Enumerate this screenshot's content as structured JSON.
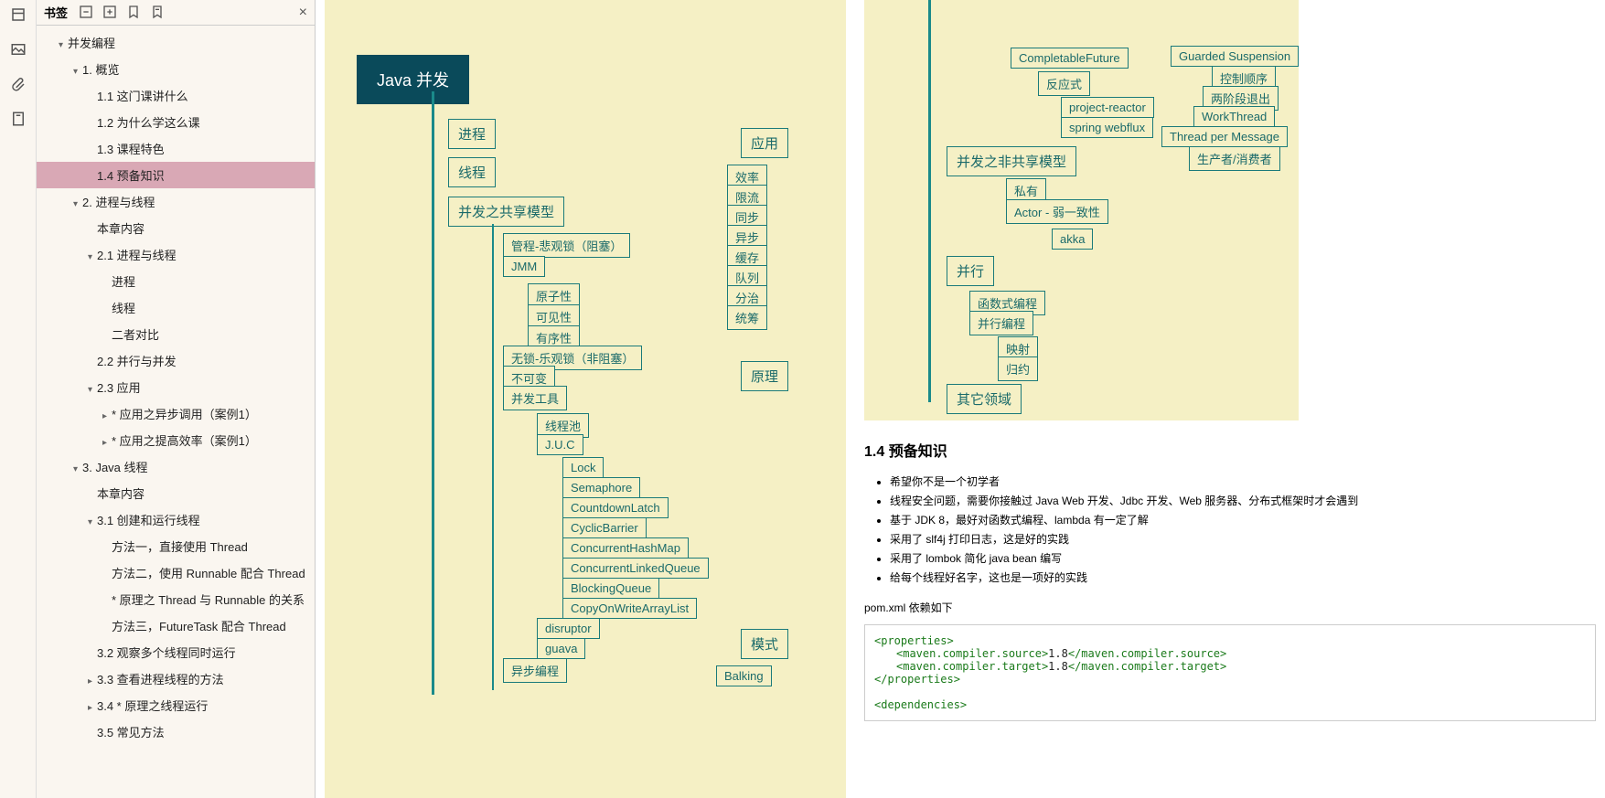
{
  "sidebar": {
    "title": "书签",
    "items": [
      {
        "label": "并发编程",
        "indent": 1,
        "arrow": "▾"
      },
      {
        "label": "1. 概览",
        "indent": 2,
        "arrow": "▾"
      },
      {
        "label": "1.1 这门课讲什么",
        "indent": 3,
        "arrow": ""
      },
      {
        "label": "1.2 为什么学这么课",
        "indent": 3,
        "arrow": ""
      },
      {
        "label": "1.3 课程特色",
        "indent": 3,
        "arrow": ""
      },
      {
        "label": "1.4 预备知识",
        "indent": 3,
        "arrow": "",
        "selected": true
      },
      {
        "label": "2. 进程与线程",
        "indent": 2,
        "arrow": "▾"
      },
      {
        "label": "本章内容",
        "indent": 3,
        "arrow": ""
      },
      {
        "label": "2.1 进程与线程",
        "indent": 3,
        "arrow": "▾"
      },
      {
        "label": "进程",
        "indent": 4,
        "arrow": ""
      },
      {
        "label": "线程",
        "indent": 4,
        "arrow": ""
      },
      {
        "label": "二者对比",
        "indent": 4,
        "arrow": ""
      },
      {
        "label": "2.2 并行与并发",
        "indent": 3,
        "arrow": ""
      },
      {
        "label": "2.3 应用",
        "indent": 3,
        "arrow": "▾"
      },
      {
        "label": "* 应用之异步调用（案例1）",
        "indent": 4,
        "arrow": "▸"
      },
      {
        "label": "* 应用之提高效率（案例1）",
        "indent": 4,
        "arrow": "▸"
      },
      {
        "label": "3. Java 线程",
        "indent": 2,
        "arrow": "▾"
      },
      {
        "label": "本章内容",
        "indent": 3,
        "arrow": ""
      },
      {
        "label": "3.1 创建和运行线程",
        "indent": 3,
        "arrow": "▾"
      },
      {
        "label": "方法一，直接使用 Thread",
        "indent": 4,
        "arrow": ""
      },
      {
        "label": "方法二，使用 Runnable 配合 Thread",
        "indent": 4,
        "arrow": ""
      },
      {
        "label": "* 原理之 Thread 与 Runnable 的关系",
        "indent": 4,
        "arrow": ""
      },
      {
        "label": "方法三，FutureTask 配合 Thread",
        "indent": 4,
        "arrow": ""
      },
      {
        "label": "3.2 观察多个线程同时运行",
        "indent": 3,
        "arrow": ""
      },
      {
        "label": "3.3 查看进程线程的方法",
        "indent": 3,
        "arrow": "▸"
      },
      {
        "label": "3.4 * 原理之线程运行",
        "indent": 3,
        "arrow": "▸"
      },
      {
        "label": "3.5 常见方法",
        "indent": 3,
        "arrow": ""
      }
    ]
  },
  "mindmap_left": {
    "root": "Java 并发",
    "l1": {
      "process": "进程",
      "thread": "线程",
      "shared": "并发之共享模型"
    },
    "shared": {
      "monitor": "管程-悲观锁（阻塞）",
      "jmm": "JMM",
      "jmm_children": {
        "atomic": "原子性",
        "visible": "可见性",
        "order": "有序性"
      },
      "lockfree": "无锁-乐观锁（非阻塞）",
      "immutable": "不可变",
      "tools": "并发工具",
      "tools_children": {
        "pool": "线程池",
        "juc": "J.U.C",
        "juc_items": {
          "lock": "Lock",
          "semaphore": "Semaphore",
          "cdl": "CountdownLatch",
          "cb": "CyclicBarrier",
          "chm": "ConcurrentHashMap",
          "clq": "ConcurrentLinkedQueue",
          "bq": "BlockingQueue",
          "cowal": "CopyOnWriteArrayList"
        },
        "disruptor": "disruptor",
        "guava": "guava"
      },
      "async": "异步编程"
    },
    "right_col": {
      "app": "应用",
      "app_items": {
        "eff": "效率",
        "limit": "限流",
        "sync": "同步",
        "async": "异步",
        "cache": "缓存",
        "queue": "队列",
        "divide": "分治",
        "plan": "统筹"
      },
      "principle": "原理",
      "pattern": "模式",
      "balking": "Balking"
    }
  },
  "mindmap_right": {
    "top_boxes": {
      "cf": "CompletableFuture",
      "reactive": "反应式",
      "pr": "project-reactor",
      "sw": "spring webflux"
    },
    "top_right": {
      "gs": "Guarded Suspension",
      "ctrl": "控制顺序",
      "two": "两阶段退出",
      "wt": "WorkThread",
      "tpm": "Thread per Message",
      "pc": "生产者/消费者"
    },
    "nonshared": "并发之非共享模型",
    "nonshared_items": {
      "private": "私有",
      "actor": "Actor - 弱一致性",
      "akka": "akka"
    },
    "parallel": "并行",
    "parallel_items": {
      "func": "函数式编程",
      "pp": "并行编程",
      "map": "映射",
      "reduce": "归约"
    },
    "other": "其它领域"
  },
  "doc": {
    "heading": "1.4 预备知识",
    "bullets": [
      "希望你不是一个初学者",
      "线程安全问题，需要你接触过 Java Web 开发、Jdbc 开发、Web 服务器、分布式框架时才会遇到",
      "基于 JDK 8，最好对函数式编程、lambda 有一定了解",
      "采用了 slf4j 打印日志，这是好的实践",
      "采用了 lombok 简化 java bean 编写",
      "给每个线程好名字，这也是一项好的实践"
    ],
    "code_intro": "pom.xml 依赖如下",
    "code": {
      "t_prop_o": "<properties>",
      "l1_a": "<maven.compiler.source>",
      "l1_b": "1.8",
      "l1_c": "</maven.compiler.source>",
      "l2_a": "<maven.compiler.target>",
      "l2_b": "1.8",
      "l2_c": "</maven.compiler.target>",
      "t_prop_c": "</properties>",
      "t_dep_o": "<dependencies>"
    }
  }
}
